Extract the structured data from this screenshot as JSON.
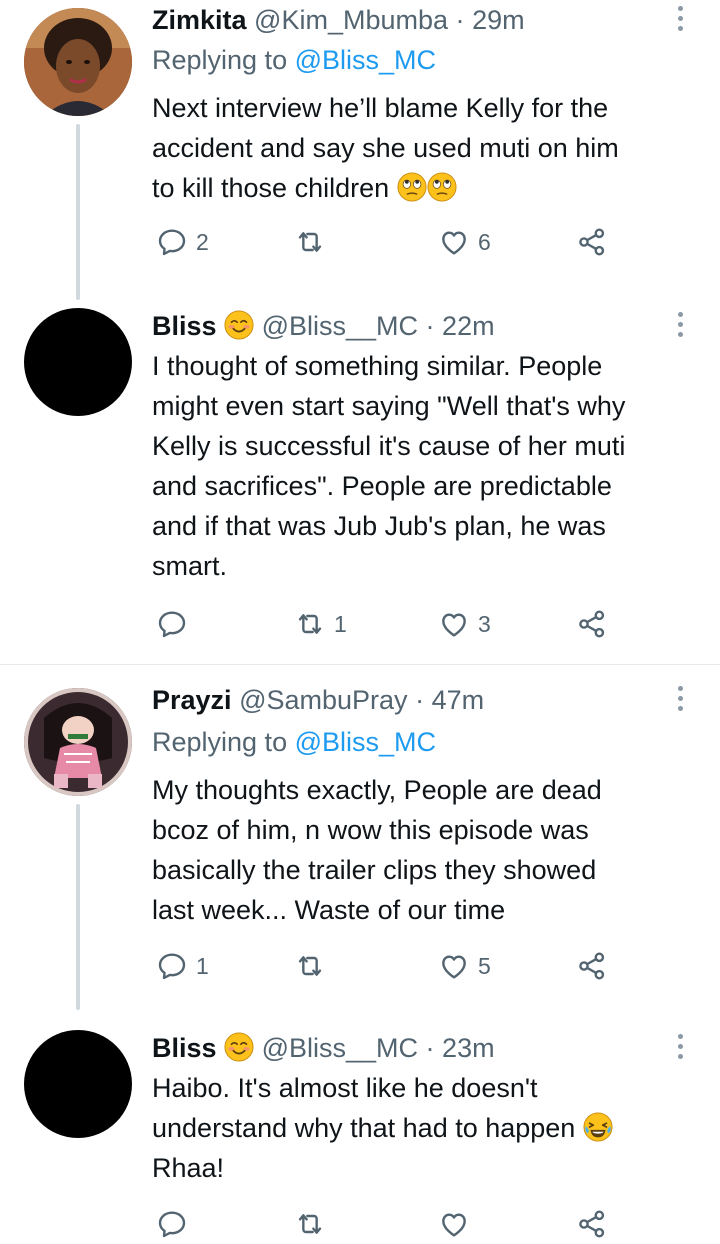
{
  "tweets": [
    {
      "name": "Zimkita",
      "handle": "@Kim_Mbumba",
      "dot": "·",
      "time": "29m",
      "replying_prefix": "Replying to",
      "replying_handle": "@Bliss_MC",
      "text_lines": [
        "Next interview he’ll blame Kelly for the",
        "accident and say she used muti on him",
        "to kill those children"
      ],
      "trailing_emoji": "rolling-eyes-emoji x2",
      "replies": "2",
      "retweets": "",
      "likes": "6"
    },
    {
      "name": "Bliss",
      "name_emoji": "smiling-face-emoji",
      "handle": "@Bliss__MC",
      "dot": "·",
      "time": "22m",
      "text_lines": [
        "I thought of something similar. People",
        "might even start saying \"Well that's why",
        "Kelly is successful it's cause of her muti",
        "and sacrifices\". People are predictable",
        "and if that was Jub Jub's plan, he was",
        "smart."
      ],
      "replies": "",
      "retweets": "1",
      "likes": "3"
    },
    {
      "name": "Prayzi",
      "handle": "@SambuPray",
      "dot": "·",
      "time": "47m",
      "replying_prefix": "Replying to",
      "replying_handle": "@Bliss_MC",
      "text_lines": [
        "My thoughts exactly, People are dead",
        "bcoz of him, n wow this episode was",
        "basically the trailer clips they showed",
        "last week... Waste of our time"
      ],
      "replies": "1",
      "retweets": "",
      "likes": "5"
    },
    {
      "name": "Bliss",
      "name_emoji": "smiling-face-emoji",
      "handle": "@Bliss__MC",
      "dot": "·",
      "time": "23m",
      "text_lines": [
        "Haibo. It's almost like he doesn't",
        "understand why that had to happen",
        "Rhaa!"
      ],
      "trailing_emoji": "tears-of-joy-emoji",
      "replies": "",
      "retweets": "",
      "likes": ""
    }
  ],
  "colors": {
    "accent": "#1d9bf0",
    "secondary": "#536471",
    "line": "#cfd9de"
  }
}
